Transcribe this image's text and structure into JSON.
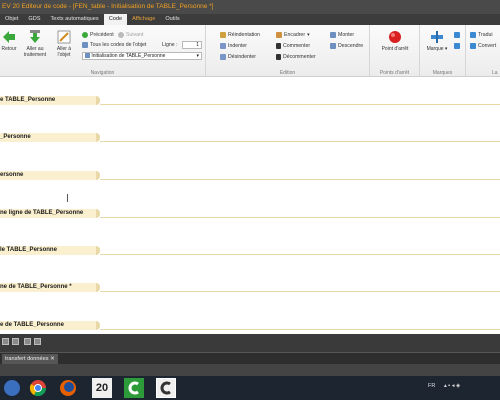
{
  "window": {
    "title": "EV 20  Editeur de code - [FEN_table - Initialisation de TABLE_Personne *]"
  },
  "tabs": [
    {
      "label": "Objet"
    },
    {
      "label": "GDS"
    },
    {
      "label": "Texts automatiques"
    },
    {
      "label": "Code"
    },
    {
      "label": "Affichage"
    },
    {
      "label": "Outils"
    }
  ],
  "ribbon": {
    "navigation": {
      "label": "Navigation",
      "retour": "Retour",
      "aller_traitement_1": "Aller au",
      "aller_traitement_2": "traitement",
      "aller_objet_1": "Aller à",
      "aller_objet_2": "l'objet",
      "precedent": "Précédent",
      "suivant": "Suivant",
      "tous_codes": "Tous les codes de l'objet",
      "ligne_label": "Ligne :",
      "ligne_value": "1",
      "init_combo": "Initialisation de TABLE_Personne"
    },
    "edition": {
      "label": "Edition",
      "reindentation": "Réindentation",
      "indenter": "Indenter",
      "desindenter": "Désindenter",
      "encadrer": "Encadrer",
      "commenter": "Commenter",
      "decommenter": "Décommenter",
      "monter": "Monter",
      "descendre": "Descendre"
    },
    "points_arret": {
      "label": "Points d'arrêt",
      "point_arret": "Point d'arrêt"
    },
    "marques": {
      "label": "Marques",
      "marque": "Marque"
    },
    "langue": {
      "label": "La",
      "traduire": "Tradui",
      "convertir": "Convert"
    }
  },
  "editor": {
    "sections": [
      {
        "text": "e TABLE_Personne"
      },
      {
        "text": "_Personne"
      },
      {
        "text": "ersonne"
      },
      {
        "text": "ne ligne de TABLE_Personne"
      },
      {
        "text": "le TABLE_Personne"
      },
      {
        "text": "ne de TABLE_Personne *"
      },
      {
        "text": "e de TABLE_Personne"
      }
    ]
  },
  "doc_tabs": [
    {
      "label": "transfert données ✕"
    }
  ],
  "taskbar": {
    "lang": "FR",
    "app_version": "20"
  },
  "colors": {
    "title_accent": "#f0a020",
    "section_bg": "#faefcf",
    "section_rule": "#e9d9a9",
    "code_tab_orange": "#e8a23a"
  }
}
